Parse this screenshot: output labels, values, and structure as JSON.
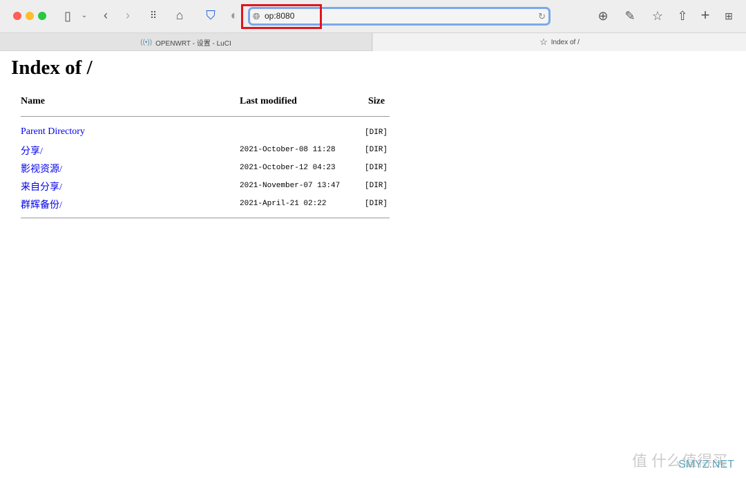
{
  "browser": {
    "url": "op:8080",
    "tabs": [
      {
        "label": "OPENWRT - 设置 - LuCI"
      },
      {
        "label": "Index of /"
      }
    ],
    "colors": {
      "close": "#fe5f57",
      "minimize": "#febc2e",
      "maximize": "#28c840",
      "highlight": "#e0141e"
    }
  },
  "page": {
    "title": "Index of /",
    "columns": {
      "name": "Name",
      "modified": "Last modified",
      "size": "Size"
    },
    "rows": [
      {
        "name": "Parent Directory",
        "modified": "",
        "size": "[DIR]"
      },
      {
        "name": "分享/",
        "modified": "2021-October-08 11:28",
        "size": "[DIR]"
      },
      {
        "name": "影视资源/",
        "modified": "2021-October-12 04:23",
        "size": "[DIR]"
      },
      {
        "name": "来自分享/",
        "modified": "2021-November-07 13:47",
        "size": "[DIR]"
      },
      {
        "name": "群辉备份/",
        "modified": "2021-April-21 02:22",
        "size": "[DIR]"
      }
    ]
  },
  "watermark": {
    "text": "值 什么值得买",
    "site": "SMYZ.NET"
  }
}
